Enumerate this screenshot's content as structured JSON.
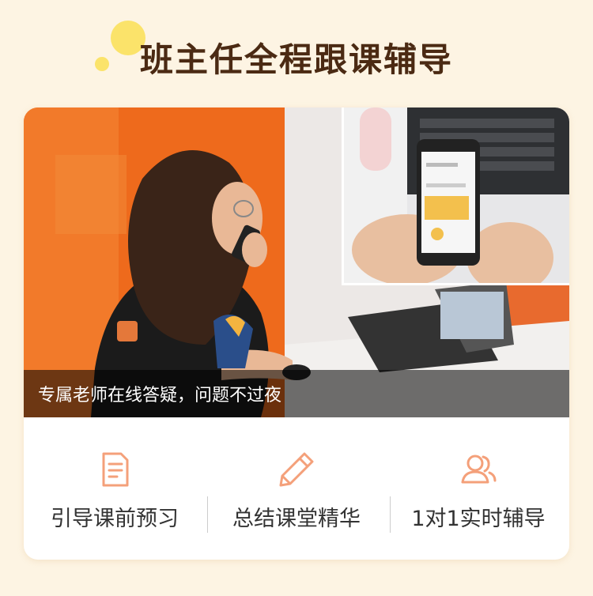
{
  "header": {
    "title": "班主任全程跟课辅导"
  },
  "photo": {
    "caption": "专属老师在线答疑，问题不过夜"
  },
  "features": [
    {
      "icon": "document-icon",
      "label": "引导课前预习"
    },
    {
      "icon": "pencil-icon",
      "label": "总结课堂精华"
    },
    {
      "icon": "users-icon",
      "label": "1对1实时辅导"
    }
  ],
  "colors": {
    "background": "#fdf4e3",
    "title": "#4b2a13",
    "accent": "#f4a07a",
    "dot": "#fbe36a"
  }
}
